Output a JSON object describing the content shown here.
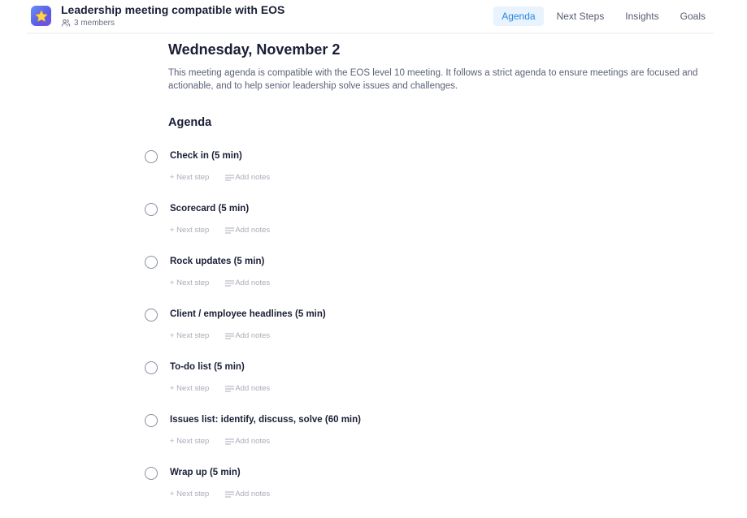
{
  "header": {
    "app_icon": "star-icon",
    "title": "Leadership meeting compatible with EOS",
    "members_icon": "users-icon",
    "members_label": "3 members",
    "tabs": [
      {
        "label": "Agenda",
        "active": true
      },
      {
        "label": "Next Steps",
        "active": false
      },
      {
        "label": "Insights",
        "active": false
      },
      {
        "label": "Goals",
        "active": false
      }
    ]
  },
  "main": {
    "date_heading": "Wednesday, November 2",
    "description": "This meeting agenda is compatible with the EOS level 10 meeting. It follows a strict agenda to ensure meetings are focused and actionable, and to help senior leadership solve issues and challenges.",
    "agenda_heading": "Agenda",
    "agenda_items": [
      {
        "title": "Check in (5 min)",
        "next_step_label": "+ Next step",
        "add_notes_label": "Add notes",
        "done": false
      },
      {
        "title": "Scorecard (5 min)",
        "next_step_label": "+ Next step",
        "add_notes_label": "Add notes",
        "done": false
      },
      {
        "title": "Rock updates (5 min)",
        "next_step_label": "+ Next step",
        "add_notes_label": "Add notes",
        "done": false
      },
      {
        "title": "Client / employee headlines (5 min)",
        "next_step_label": "+ Next step",
        "add_notes_label": "Add notes",
        "done": false
      },
      {
        "title": "To-do list (5 min)",
        "next_step_label": "+ Next step",
        "add_notes_label": "Add notes",
        "done": false
      },
      {
        "title": "Issues list: identify, discuss, solve (60 min)",
        "next_step_label": "+ Next step",
        "add_notes_label": "Add notes",
        "done": false
      },
      {
        "title": "Wrap up (5 min)",
        "next_step_label": "+ Next step",
        "add_notes_label": "Add notes",
        "done": false
      }
    ]
  },
  "colors": {
    "accent": "#2e86de",
    "active_tab_bg": "#e8f3fd",
    "text_primary": "#1a1f36",
    "text_muted": "#a9adb8"
  }
}
